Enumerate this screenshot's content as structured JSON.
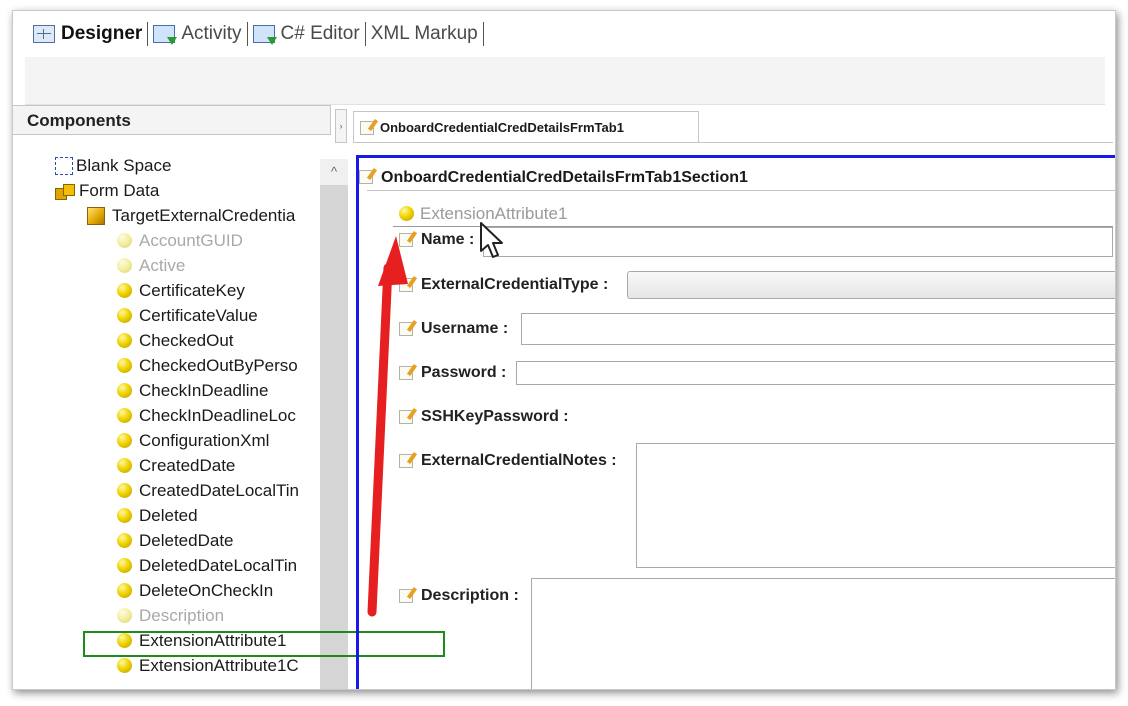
{
  "top_tabs": [
    {
      "label": "Designer",
      "icon": "grid-icon",
      "active": true
    },
    {
      "label": "Activity",
      "icon": "download-icon",
      "active": false
    },
    {
      "label": "C# Editor",
      "icon": "download-icon",
      "active": false
    },
    {
      "label": "XML Markup",
      "active": false
    }
  ],
  "components": {
    "title": "Components",
    "items": [
      {
        "label": "Blank Space",
        "icon": "blank-space-icon",
        "disabled": false
      },
      {
        "label": "Form Data",
        "icon": "cubes-icon",
        "disabled": false
      },
      {
        "label": "TargetExternalCredentia",
        "icon": "cube-icon",
        "disabled": false
      },
      {
        "label": "AccountGUID",
        "icon": "field-ball-icon",
        "disabled": true
      },
      {
        "label": "Active",
        "icon": "field-ball-icon",
        "disabled": true
      },
      {
        "label": "CertificateKey",
        "icon": "field-ball-icon",
        "disabled": false
      },
      {
        "label": "CertificateValue",
        "icon": "field-ball-icon",
        "disabled": false
      },
      {
        "label": "CheckedOut",
        "icon": "field-ball-icon",
        "disabled": false
      },
      {
        "label": "CheckedOutByPerso",
        "icon": "field-ball-icon",
        "disabled": false
      },
      {
        "label": "CheckInDeadline",
        "icon": "field-ball-icon",
        "disabled": false
      },
      {
        "label": "CheckInDeadlineLoc",
        "icon": "field-ball-icon",
        "disabled": false
      },
      {
        "label": "ConfigurationXml",
        "icon": "field-ball-icon",
        "disabled": false
      },
      {
        "label": "CreatedDate",
        "icon": "field-ball-icon",
        "disabled": false
      },
      {
        "label": "CreatedDateLocalTin",
        "icon": "field-ball-icon",
        "disabled": false
      },
      {
        "label": "Deleted",
        "icon": "field-ball-icon",
        "disabled": false
      },
      {
        "label": "DeletedDate",
        "icon": "field-ball-icon",
        "disabled": false
      },
      {
        "label": "DeletedDateLocalTin",
        "icon": "field-ball-icon",
        "disabled": false
      },
      {
        "label": "DeleteOnCheckIn",
        "icon": "field-ball-icon",
        "disabled": false
      },
      {
        "label": "Description",
        "icon": "field-ball-icon",
        "disabled": true
      },
      {
        "label": "ExtensionAttribute1",
        "icon": "field-ball-icon",
        "disabled": false,
        "highlighted": true
      },
      {
        "label": "ExtensionAttribute1C",
        "icon": "field-ball-icon",
        "disabled": false
      }
    ]
  },
  "designer": {
    "tab_label": "OnboardCredentialCredDetailsFrmTab1",
    "section_label": "OnboardCredentialCredDetailsFrmTab1Section1",
    "dragged_field": "ExtensionAttribute1",
    "fields": [
      {
        "label": "Name :",
        "type": "text"
      },
      {
        "label": "ExternalCredentialType :",
        "type": "combo"
      },
      {
        "label": "Username :",
        "type": "text"
      },
      {
        "label": "Password :",
        "type": "text"
      },
      {
        "label": "SSHKeyPassword :",
        "type": "none"
      },
      {
        "label": "ExternalCredentialNotes :",
        "type": "textarea"
      },
      {
        "label": "Description :",
        "type": "textarea"
      }
    ]
  },
  "annotation": {
    "arrow_color": "#e62020",
    "highlight_color": "#1e8a1e",
    "section_border_color": "#1a1ae6"
  }
}
